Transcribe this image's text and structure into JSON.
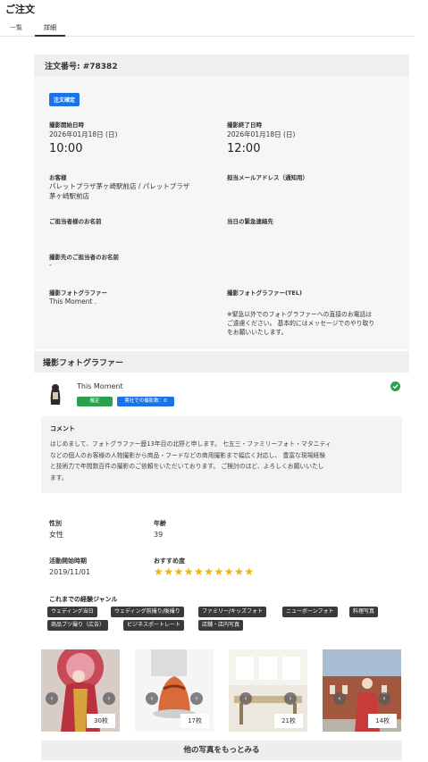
{
  "page": {
    "title": "ご注文"
  },
  "tabs": [
    {
      "label": "一覧"
    },
    {
      "label": "詳細"
    }
  ],
  "order": {
    "number_label": "注文番号: #78382",
    "status_badge": "注文確定",
    "start_label": "撮影開始日時",
    "start_date": "2026年01月18日 (日)",
    "start_time": "10:00",
    "end_label": "撮影終了日時",
    "end_date": "2026年01月18日 (日)",
    "end_time": "12:00",
    "customer_label": "お客様",
    "customer_line1": "パレットプラザ茅ヶ崎駅前店 / パレットプラザ",
    "customer_line2": "茅ヶ崎駅前店",
    "email_label": "担当メールアドレス（通知用）",
    "contact_label": "ご担当者様のお名前",
    "emergency_label": "当日の緊急連絡先",
    "site_contact_label": "撮影先のご担当者のお名前",
    "site_contact_value": "-",
    "photographer_label": "撮影フォトグラファー",
    "photographer_value": "This Moment .",
    "photographer_tel_label": "撮影フォトグラファー(TEL)",
    "tel_note_line1": "※緊急以外でのフォトグラファーへの直接のお電話は",
    "tel_note_line2": "ご遠慮ください。 基本的にはメッセージでのやり取り",
    "tel_note_line3": "をお願いいたします。"
  },
  "photographer": {
    "section_title": "撮影フォトグラファー",
    "name": "This Moment",
    "badge_confirmed": "確定",
    "badge_count": "貴社での撮影数：0",
    "comment_label": "コメント",
    "comment_line1": "はじめまして、フォトグラファー歴13年目の北野と申します。 七五三・ファミリーフォト・マタニティ",
    "comment_line2": "などの個人のお客様の人物撮影から商品・フードなどの商用撮影まで幅広く対応し、 豊富な現場経験",
    "comment_line3": "と技術力で年間数百件の撮影のご依頼をいただいております。 ご検討のほど、よろしくお願いいたし",
    "comment_line4": "ます。",
    "gender_label": "性別",
    "gender_value": "女性",
    "age_label": "年齢",
    "age_value": "39",
    "active_since_label": "活動開始時期",
    "active_since_value": "2019/11/01",
    "recommend_label": "おすすめ度",
    "stars": "★★★★★★★★★★",
    "recommend_score": 10,
    "genres_label": "これまでの経験ジャンル",
    "genres": [
      "ウェディング当日",
      "ウェディング前撮り/後撮り",
      "ファミリー/キッズフォト",
      "ニューボーンフォト",
      "料理写真",
      "商品ブツ撮り（広告）",
      "ビジネスポートレート",
      "店舗・店内写真"
    ],
    "photos": [
      {
        "count": "30枚"
      },
      {
        "count": "17枚"
      },
      {
        "count": "21枚"
      },
      {
        "count": "14枚"
      }
    ],
    "more_button": "他の写真をもっとみる"
  },
  "colors": {
    "accent_blue": "#1a73e8",
    "success_green": "#2aa14d",
    "star": "#f5b301",
    "tag_dark": "#3a3a3a"
  },
  "icons": {
    "confirmed": "check-circle-icon",
    "prev": "chevron-left-icon",
    "next": "chevron-right-icon"
  }
}
